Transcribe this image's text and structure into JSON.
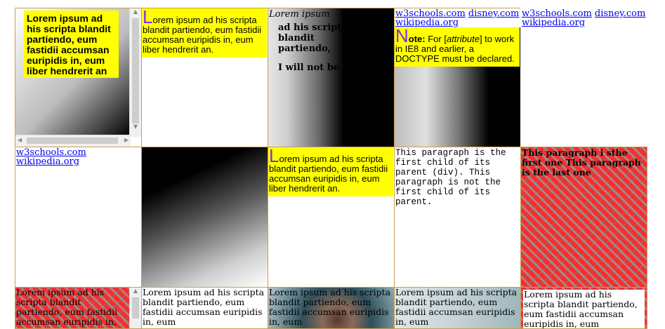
{
  "lorem_short": "Lorem ipsum ad his scripta blandit partiendo, eum fastidii accumsan euripidis in, eum liber hendrerit an",
  "lorem_full": "Lorem ipsum ad his scripta blandit partiendo, eum fastidii accumsan euripidis in, eum liber hendrerit an.",
  "lorem_tail": "orem ipsum ad his scripta blandit partiendo, eum fastidii accumsan euripidis in, eum liber hendrerit an.",
  "dropcap": "L",
  "cell3": {
    "italic": "Lorem ipsum",
    "bold1": "ad his scripta blandit partiendo,",
    "bold2": "I will not be styled."
  },
  "links": {
    "w3schools": "w3schools.com",
    "disney": "disney.com",
    "wikipedia": "wikipedia.org"
  },
  "note": {
    "letter": "N",
    "label": "ote:",
    "before": " For [",
    "attr": "attribute",
    "after": "] to work in IE8 and earlier, a DOCTYPE must be declared."
  },
  "mono_text": "This paragraph is the first child of its parent (div). This paragraph is not the first child of its parent.",
  "bold_para": "This paragraph i sthe first one This paragraph is the last one",
  "row3_lorem": "Lorem ipsum ad his scripta blandit partiendo, eum fastidii accumsan euripidis in, eum"
}
